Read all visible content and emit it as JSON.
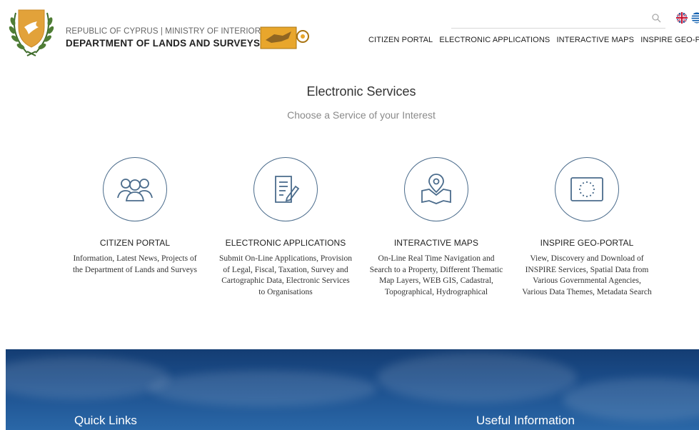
{
  "header": {
    "ministry": "REPUBLIC OF CYPRUS | MINISTRY OF INTERIOR",
    "department": "DEPARTMENT OF LANDS AND SURVEYS",
    "nav": [
      {
        "label": "CITIZEN PORTAL"
      },
      {
        "label": "ELECTRONIC APPLICATIONS"
      },
      {
        "label": "INTERACTIVE MAPS"
      },
      {
        "label": "INSPIRE GEO-PORTAL"
      }
    ]
  },
  "main": {
    "title": "Electronic Services",
    "subtitle": "Choose a Service of your Interest",
    "services": [
      {
        "title": "CITIZEN PORTAL",
        "description": "Information, Latest News, Projects of the Department of Lands and Surveys",
        "icon": "people-icon"
      },
      {
        "title": "ELECTRONIC APPLICATIONS",
        "description": "Submit On-Line Applications, Provision of Legal, Fiscal, Taxation, Survey and Cartographic Data, Electronic Services to Organisations",
        "icon": "document-edit-icon"
      },
      {
        "title": "INTERACTIVE MAPS",
        "description": "On-Line Real Time Navigation and Search to a Property, Different Thematic Map Layers, WEB GIS, Cadastral, Topographical, Hydrographical",
        "icon": "map-pin-icon"
      },
      {
        "title": "INSPIRE GEO-PORTAL",
        "description": "View, Discovery and Download of INSPIRE Services, Spatial Data from Various Governmental Agencies, Various Data Themes, Metadata Search",
        "icon": "eu-flag-icon"
      }
    ]
  },
  "footer": {
    "quick_links": "Quick Links",
    "useful_information": "Useful Information"
  },
  "colors": {
    "icon_stroke": "#4b6c8c",
    "footer_blue": "#1c4f8d",
    "emblem_gold": "#e2a23a"
  }
}
